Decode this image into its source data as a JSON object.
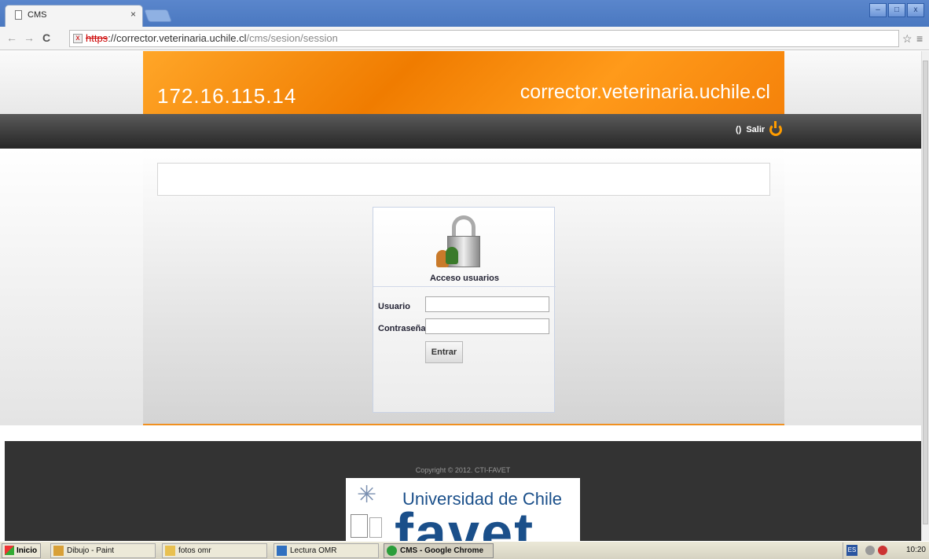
{
  "browser": {
    "tab_title": "CMS",
    "url_protocol": "https",
    "url_host": "://corrector.veterinaria.uchile.cl",
    "url_path": "/cms/sesion/session"
  },
  "banner": {
    "ip": "172.16.115.14",
    "host": "corrector.veterinaria.uchile.cl"
  },
  "navbar": {
    "user_placeholder": "()",
    "logout_label": "Salir"
  },
  "login": {
    "title": "Acceso usuarios",
    "user_label": "Usuario",
    "password_label": "Contraseña",
    "user_value": "",
    "password_value": "",
    "submit_label": "Entrar"
  },
  "footer": {
    "copyright": "Copyright © 2012. CTI-FAVET",
    "logo_university": "Universidad de Chile",
    "logo_faculty": "favet"
  },
  "taskbar": {
    "start_label": "Inicio",
    "items": [
      {
        "label": "Dibujo - Paint",
        "color": "#d8a038"
      },
      {
        "label": "fotos omr",
        "color": "#e8c050"
      },
      {
        "label": "Lectura OMR",
        "color": "#3070c0"
      },
      {
        "label": "CMS - Google Chrome",
        "color": "#2a9d3a"
      }
    ],
    "language": "ES",
    "clock": "10:20"
  },
  "colors": {
    "banner_orange": "#f07c00",
    "navbar_dark": "#262626",
    "accent_orange": "#ff9c00"
  }
}
